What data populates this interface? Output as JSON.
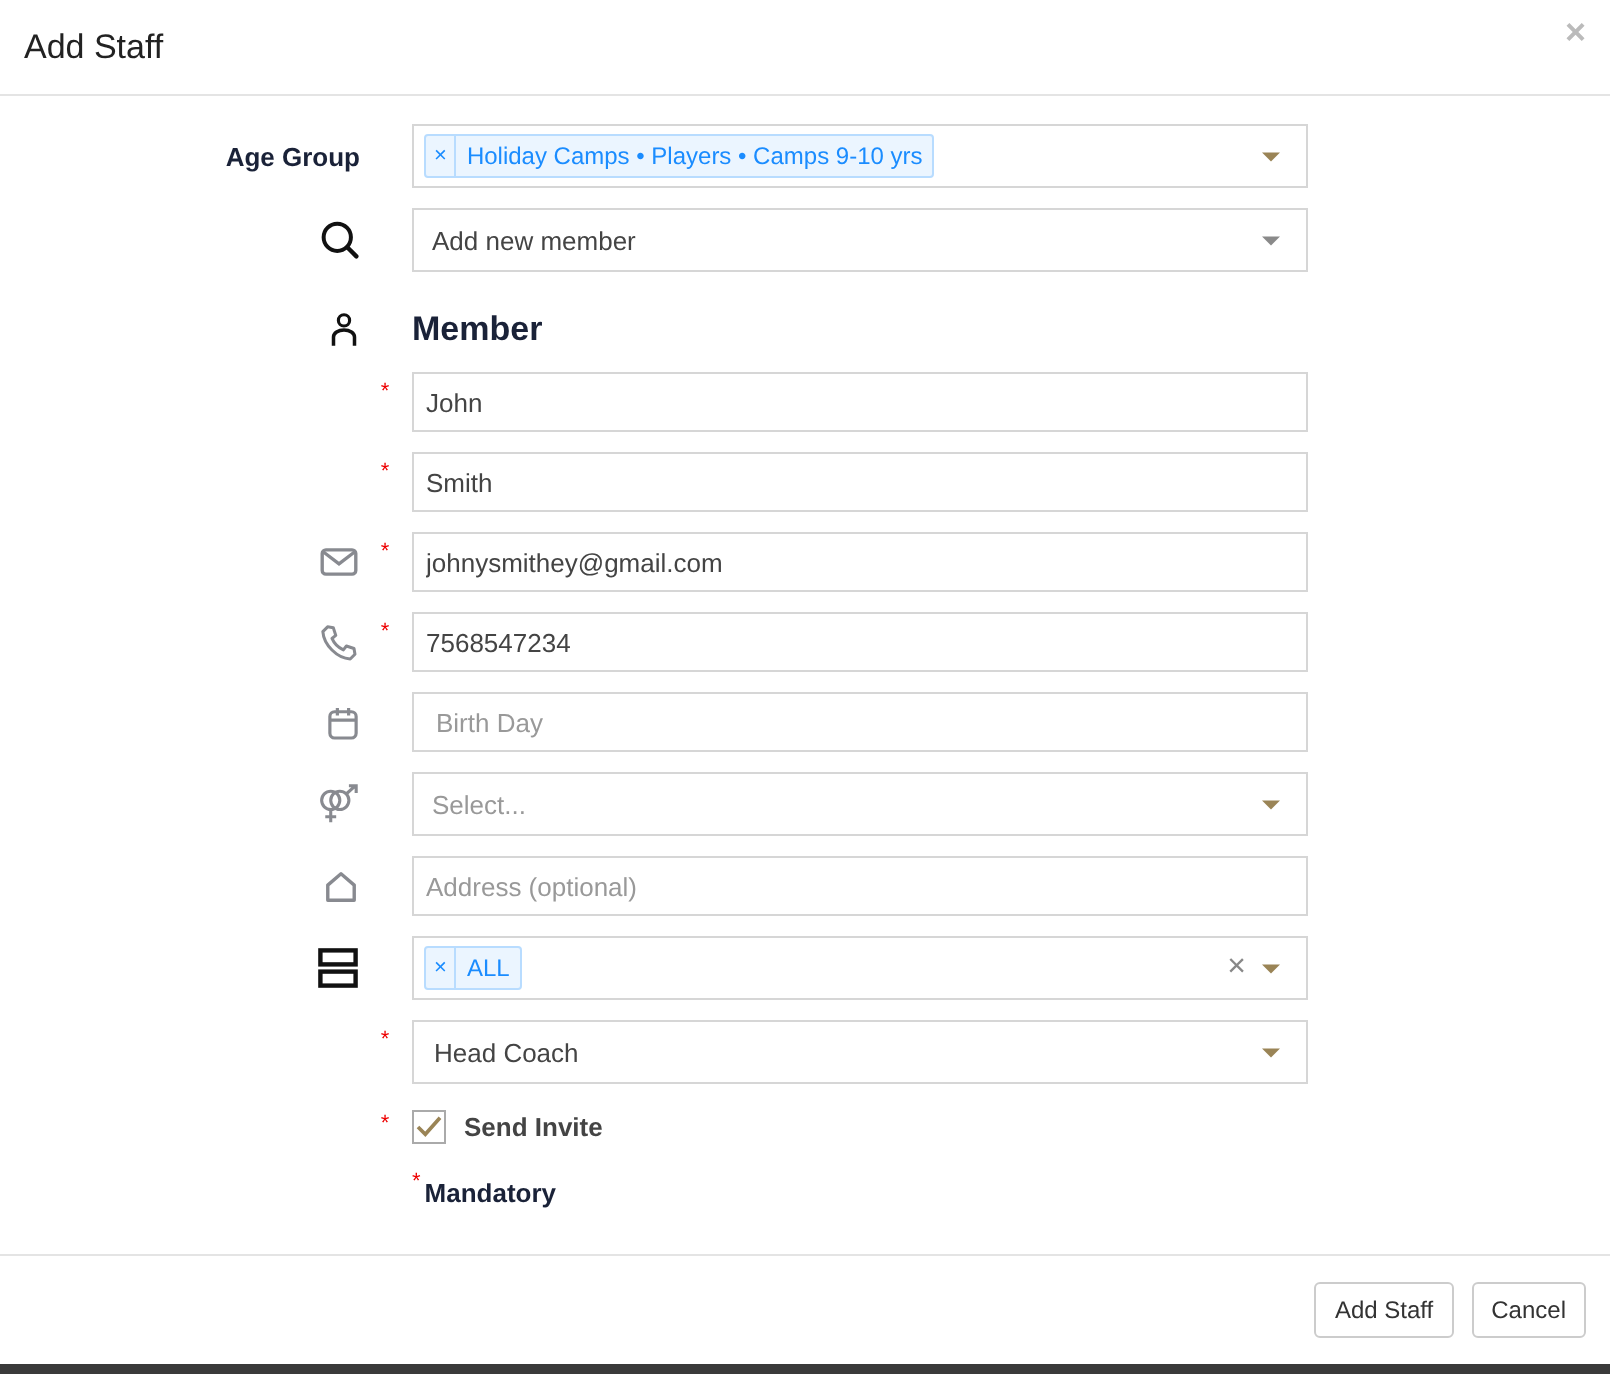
{
  "window": {
    "title": "Add Staff",
    "close": "×"
  },
  "fields": [
    {
      "kind": "tags-select",
      "label": "Age Group",
      "tags": [
        {
          "label": "Holiday Camps • Players • Camps 9-10 yrs",
          "remove": "×"
        }
      ]
    },
    {
      "kind": "search-select",
      "value": "Add new member"
    },
    {
      "kind": "heading",
      "text": "Member"
    },
    {
      "kind": "input",
      "required_mark": "*",
      "value": "John"
    },
    {
      "kind": "input",
      "required_mark": "*",
      "value": "Smith"
    },
    {
      "kind": "input",
      "required_mark": "*",
      "value": "johnysmithey@gmail.com"
    },
    {
      "kind": "input",
      "required_mark": "*",
      "value": "7568547234"
    },
    {
      "kind": "input",
      "placeholder": "Birth Day"
    },
    {
      "kind": "select",
      "placeholder": "Select..."
    },
    {
      "kind": "input",
      "placeholder": "Address (optional)"
    },
    {
      "kind": "tags-select",
      "tags": [
        {
          "label": "ALL",
          "remove": "×"
        }
      ],
      "clear": "×"
    },
    {
      "kind": "select",
      "required_mark": "*",
      "value": "Head Coach"
    },
    {
      "kind": "checkbox",
      "required_mark": "*",
      "label": "Send Invite",
      "checked": true
    },
    {
      "kind": "note",
      "required_mark": "*",
      "text": "Mandatory"
    }
  ],
  "buttons": [
    "Add Staff",
    "Cancel"
  ]
}
